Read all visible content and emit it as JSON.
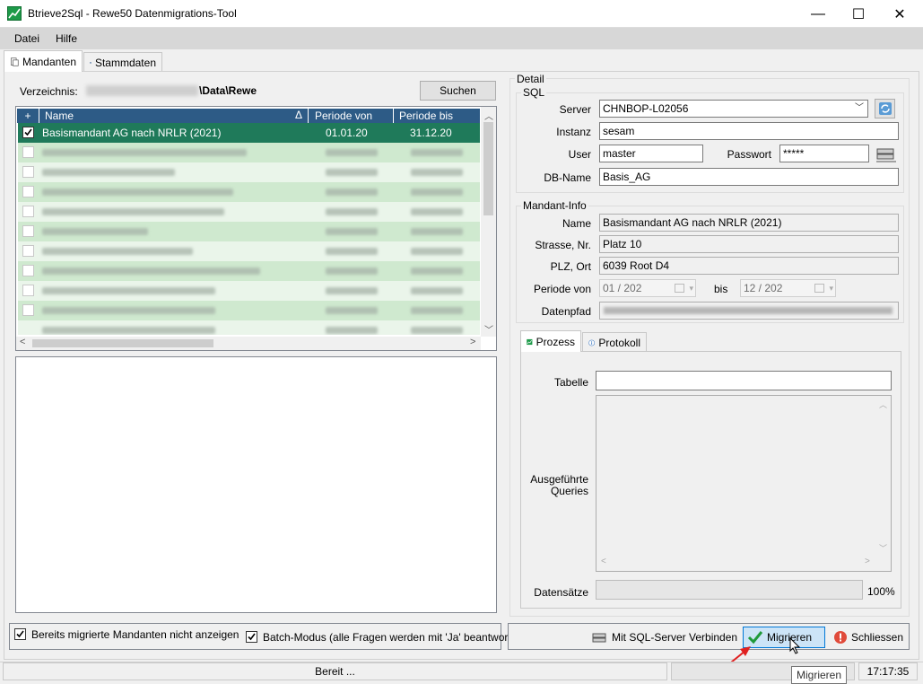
{
  "window": {
    "title": "Btrieve2Sql - Rewe50 Datenmigrations-Tool",
    "minimize": "—",
    "maximize": "☐",
    "close": "✕"
  },
  "menu": {
    "file": "Datei",
    "help": "Hilfe"
  },
  "tabs": {
    "clients": "Mandanten",
    "master_data": "Stammdaten"
  },
  "directory": {
    "label": "Verzeichnis:",
    "path_visible": "\\Data\\Rewe",
    "search_button": "Suchen"
  },
  "grid": {
    "headers": {
      "expand": "+",
      "name": "Name",
      "period_from": "Periode von",
      "period_to": "Periode bis"
    },
    "sort_indicator": "Δ",
    "selected_row": {
      "name": "Basismandant AG nach NRLR (2021)",
      "period_from": "01.01.20",
      "period_to": "31.12.20",
      "checked": true
    }
  },
  "options": {
    "hide_migrated": "Bereits migrierte Mandanten nicht anzeigen",
    "batch_mode": "Batch-Modus (alle Fragen werden mit 'Ja' beantwortet!)"
  },
  "detail": {
    "group_title": "Detail",
    "sql": {
      "group_title": "SQL",
      "server_label": "Server",
      "server_value": "CHNBOP-L02056",
      "instance_label": "Instanz",
      "instance_value": "sesam",
      "user_label": "User",
      "user_value": "master",
      "password_label": "Passwort",
      "password_value": "*****",
      "db_label": "DB-Name",
      "db_value": "Basis_AG"
    },
    "client_info": {
      "group_title": "Mandant-Info",
      "name_label": "Name",
      "name_value": "Basismandant AG nach NRLR (2021)",
      "street_label": "Strasse, Nr.",
      "street_value": "Platz 10",
      "zip_label": "PLZ, Ort",
      "zip_value": "6039 Root D4",
      "period_label": "Periode von",
      "period_from": "01 / 202",
      "period_sep": "bis",
      "period_to": "12 / 202",
      "path_label": "Datenpfad"
    },
    "process_tabs": {
      "process": "Prozess",
      "log": "Protokoll"
    },
    "process": {
      "table_label": "Tabelle",
      "queries_label_1": "Ausgeführte",
      "queries_label_2": "Queries",
      "records_label": "Datensätze",
      "records_percent": "100%"
    }
  },
  "buttons": {
    "connect": "Mit SQL-Server Verbinden",
    "migrate": "Migrieren",
    "close": "Schliessen"
  },
  "status": {
    "text": "Bereit ...",
    "time": "17:17:35"
  },
  "tooltip": "Migrieren",
  "colors": {
    "grid_header": "#2d5b86",
    "selected_row": "#1f7a5a",
    "row_alt": "#cfe9cf",
    "row_odd": "#eaf5ea",
    "migrate_button": "#cce4f7"
  }
}
